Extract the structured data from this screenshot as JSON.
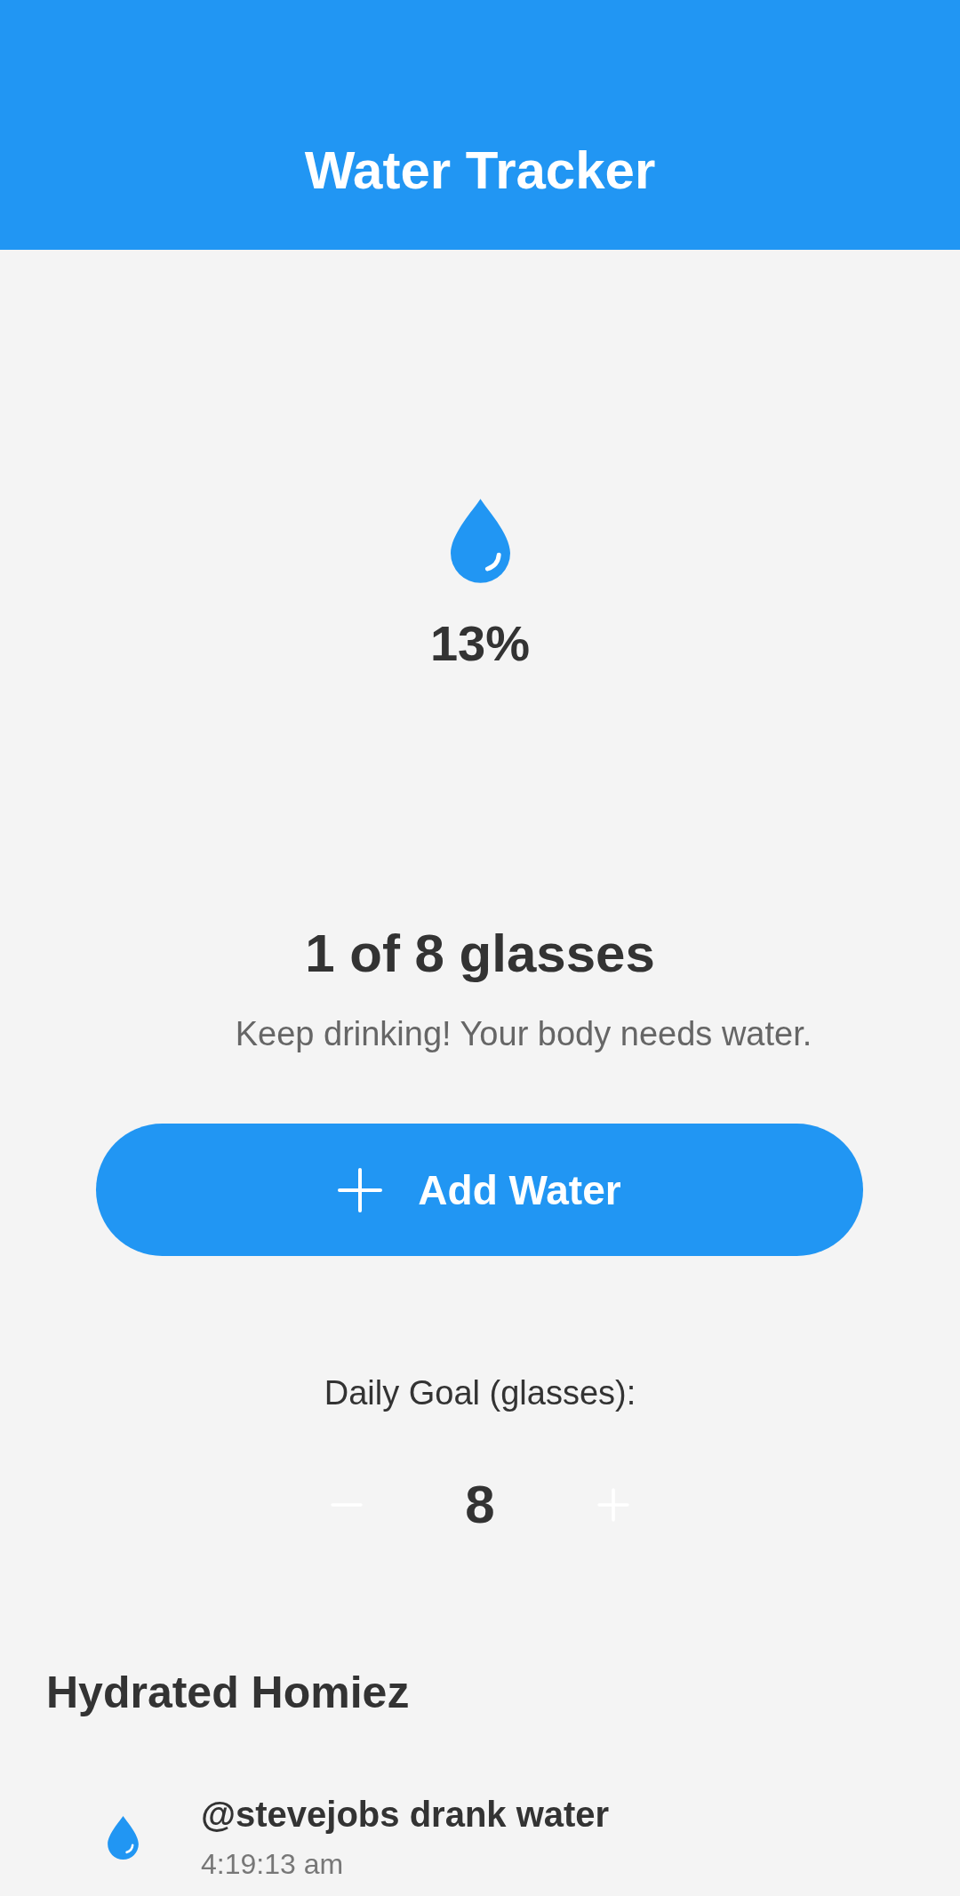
{
  "header": {
    "title": "Water Tracker"
  },
  "progress": {
    "percent": "13%"
  },
  "summary": {
    "count": "1 of 8 glasses",
    "message": "Keep drinking! Your body needs water."
  },
  "add_button": {
    "label": "Add Water"
  },
  "goal": {
    "label": "Daily Goal (glasses):",
    "value": "8"
  },
  "feed": {
    "title": "Hydrated Homiez",
    "items": [
      {
        "text": "@stevejobs drank water",
        "time": "4:19:13 am"
      }
    ]
  }
}
